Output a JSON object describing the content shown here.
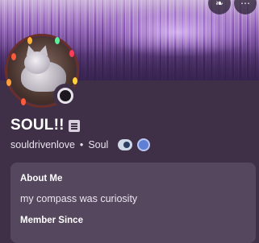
{
  "profile": {
    "display_name": "SOUL!!",
    "username": "souldrivenlove",
    "separator": "•",
    "pronouns": "Soul",
    "avatar_icon": "cat-avatar",
    "status": "offline"
  },
  "about": {
    "heading": "About Me",
    "bio": "my compass was curiosity",
    "member_since_heading": "Member Since"
  },
  "actions": {
    "nitro_icon": "boost-icon",
    "more_icon": "more-icon"
  },
  "colors": {
    "background": "#3f3047",
    "card": "#55475e",
    "banner_accent": "#8e63b1"
  }
}
